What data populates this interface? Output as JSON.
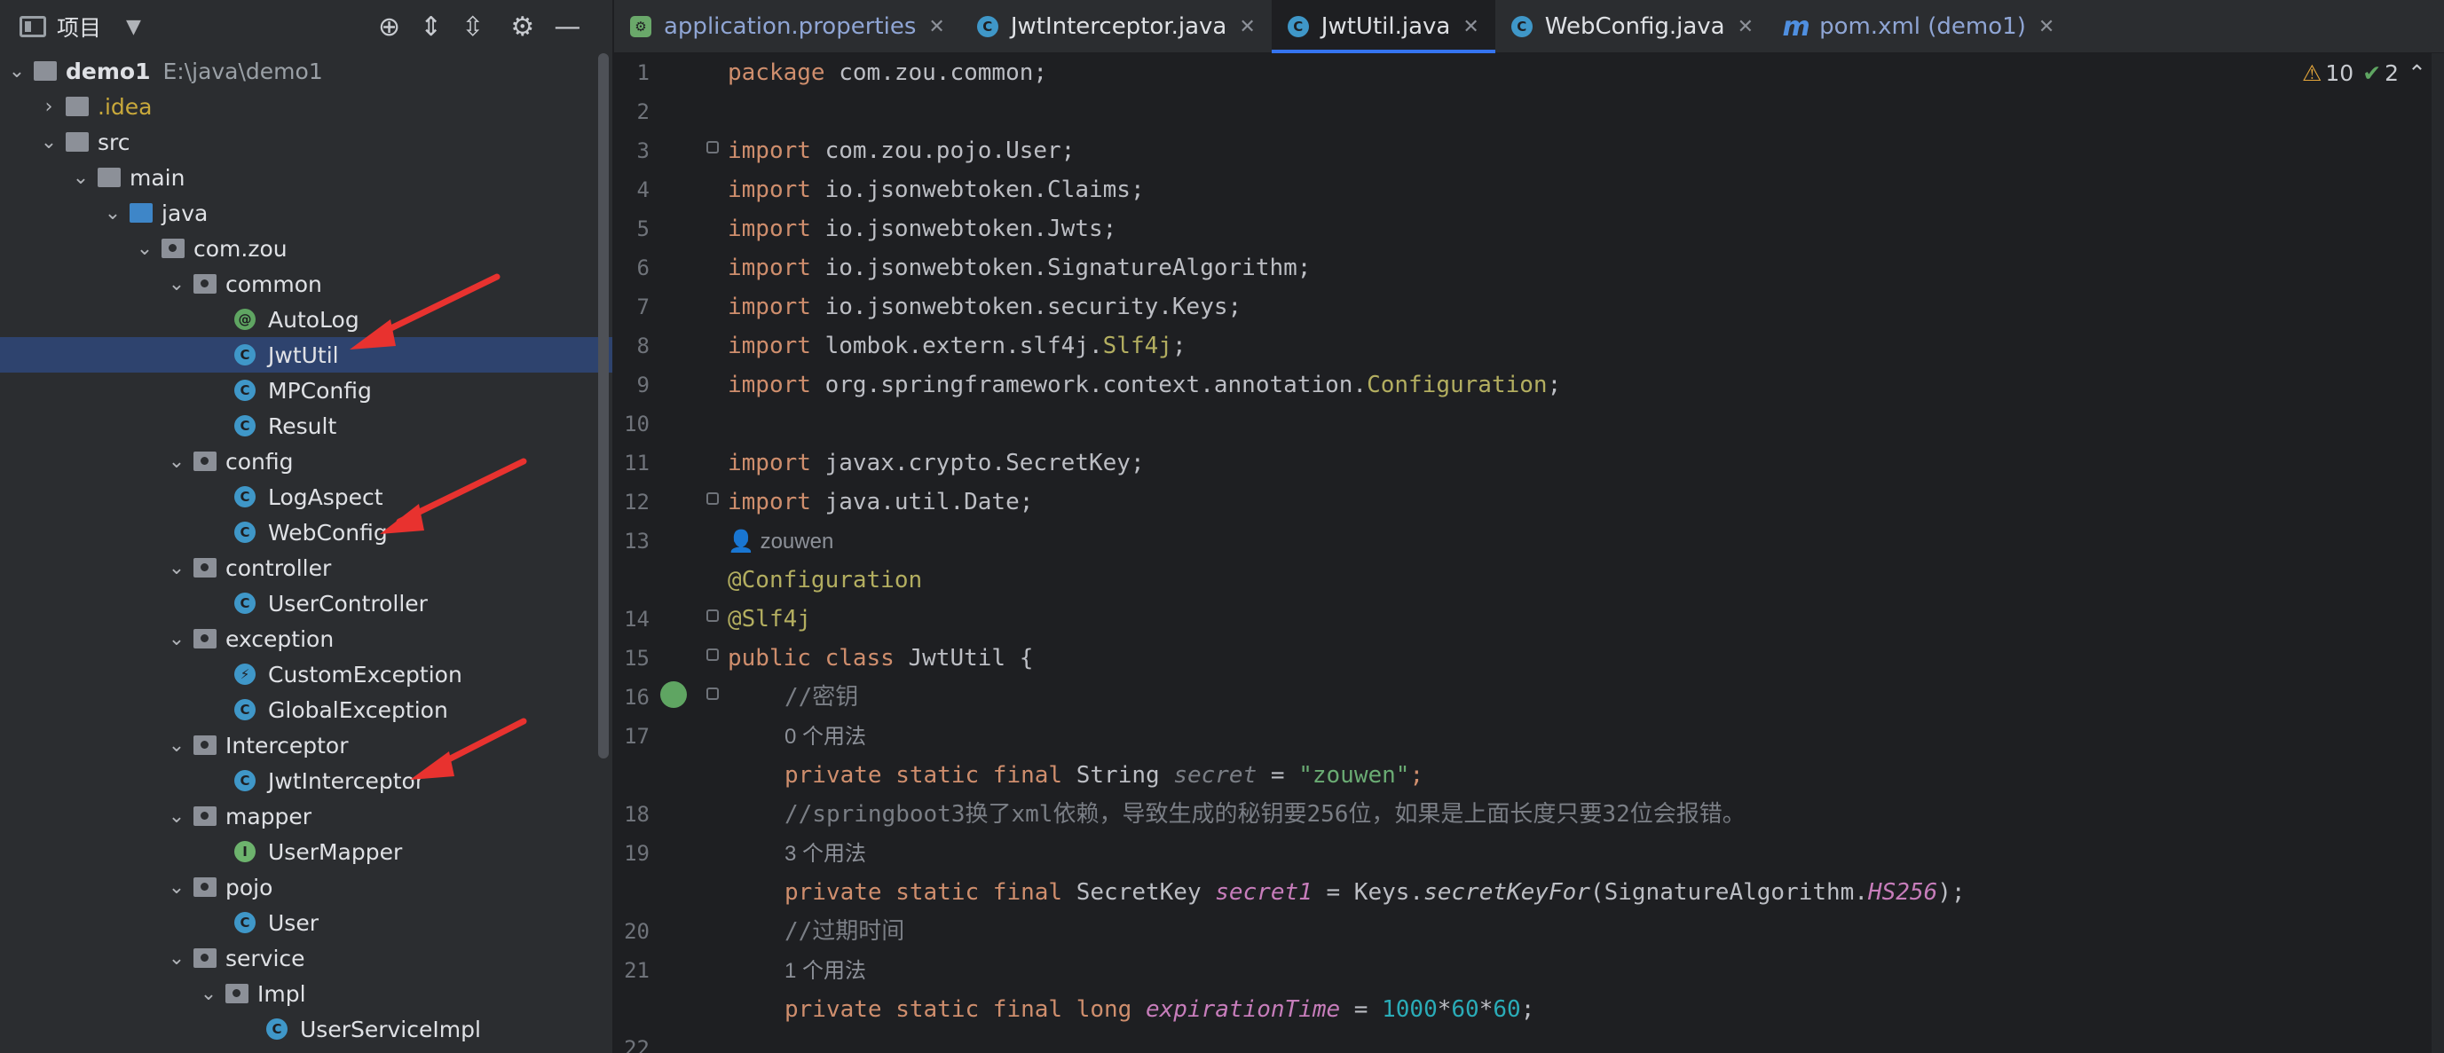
{
  "sidebar": {
    "title": "项目",
    "tree": [
      {
        "label": "demo1",
        "path": "E:\\java\\demo1",
        "bold": true
      },
      {
        "label": ".idea"
      },
      {
        "label": "src"
      },
      {
        "label": "main"
      },
      {
        "label": "java"
      },
      {
        "label": "com.zou"
      },
      {
        "label": "common"
      },
      {
        "label": "AutoLog"
      },
      {
        "label": "JwtUtil"
      },
      {
        "label": "MPConfig"
      },
      {
        "label": "Result"
      },
      {
        "label": "config"
      },
      {
        "label": "LogAspect"
      },
      {
        "label": "WebConfig"
      },
      {
        "label": "controller"
      },
      {
        "label": "UserController"
      },
      {
        "label": "exception"
      },
      {
        "label": "CustomException"
      },
      {
        "label": "GlobalException"
      },
      {
        "label": "Interceptor"
      },
      {
        "label": "JwtInterceptor"
      },
      {
        "label": "mapper"
      },
      {
        "label": "UserMapper"
      },
      {
        "label": "pojo"
      },
      {
        "label": "User"
      },
      {
        "label": "service"
      },
      {
        "label": "Impl"
      },
      {
        "label": "UserServiceImpl"
      }
    ]
  },
  "tabs": [
    {
      "label": "application.properties"
    },
    {
      "label": "JwtInterceptor.java"
    },
    {
      "label": "JwtUtil.java",
      "active": true
    },
    {
      "label": "WebConfig.java"
    },
    {
      "label": "pom.xml (demo1)"
    }
  ],
  "inspections": {
    "warnings": "10",
    "ok": "2"
  },
  "editor": {
    "line_numbers": [
      "1",
      "2",
      "3",
      "4",
      "5",
      "6",
      "7",
      "8",
      "9",
      "10",
      "11",
      "12",
      "13",
      "14",
      "15",
      "16",
      "17",
      "18",
      "19",
      "20",
      "21",
      "22"
    ],
    "author": "zouwen",
    "hints": [
      "0 个用法",
      "3 个用法",
      "1 个用法"
    ],
    "code": {
      "l1_kw": "package",
      "l1_rest": " com.zou.common;",
      "imp": "import",
      "l3": " com.zou.pojo.User;",
      "l4": " io.jsonwebtoken.Claims;",
      "l5": " io.jsonwebtoken.Jwts;",
      "l6": " io.jsonwebtoken.SignatureAlgorithm;",
      "l7": " io.jsonwebtoken.security.Keys;",
      "l8a": " lombok.extern.slf4j.",
      "l8b": "Slf4j",
      "l8c": ";",
      "l9a": " org.springframework.context.annotation.",
      "l9b": "Configuration",
      "l9c": ";",
      "l11": " javax.crypto.SecretKey;",
      "l12": " java.util.Date;",
      "l14": "@Configuration",
      "l15": "@Slf4j",
      "l16_kw": "public class",
      "l16_rest": " JwtUtil {",
      "l17": "//密钥",
      "l18_kw": "private static final",
      "l18_t": " String ",
      "l18_f": "secret",
      "l18_eq": " = ",
      "l18_s": "\"zouwen\"",
      "l18_end": ";",
      "l19": "//springboot3换了xml依赖，导致生成的秘钥要256位，如果是上面长度只要32位会报错。",
      "l20_kw": "private static final",
      "l20_t": " SecretKey ",
      "l20_f": "secret1",
      "l20_m": " = Keys.",
      "l20_call": "secretKeyFor",
      "l20_arg": "(SignatureAlgorithm.",
      "l20_c": "HS256",
      "l20_end": ");",
      "l21": "//过期时间",
      "l22_kw": "private static final long",
      "l22_sp": " ",
      "l22_f": "expirationTime",
      "l22_eq": " = ",
      "l22_n1": "1000",
      "l22_op1": "*",
      "l22_n2": "60",
      "l22_op2": "*",
      "l22_n3": "60",
      "l22_end": ";"
    }
  }
}
